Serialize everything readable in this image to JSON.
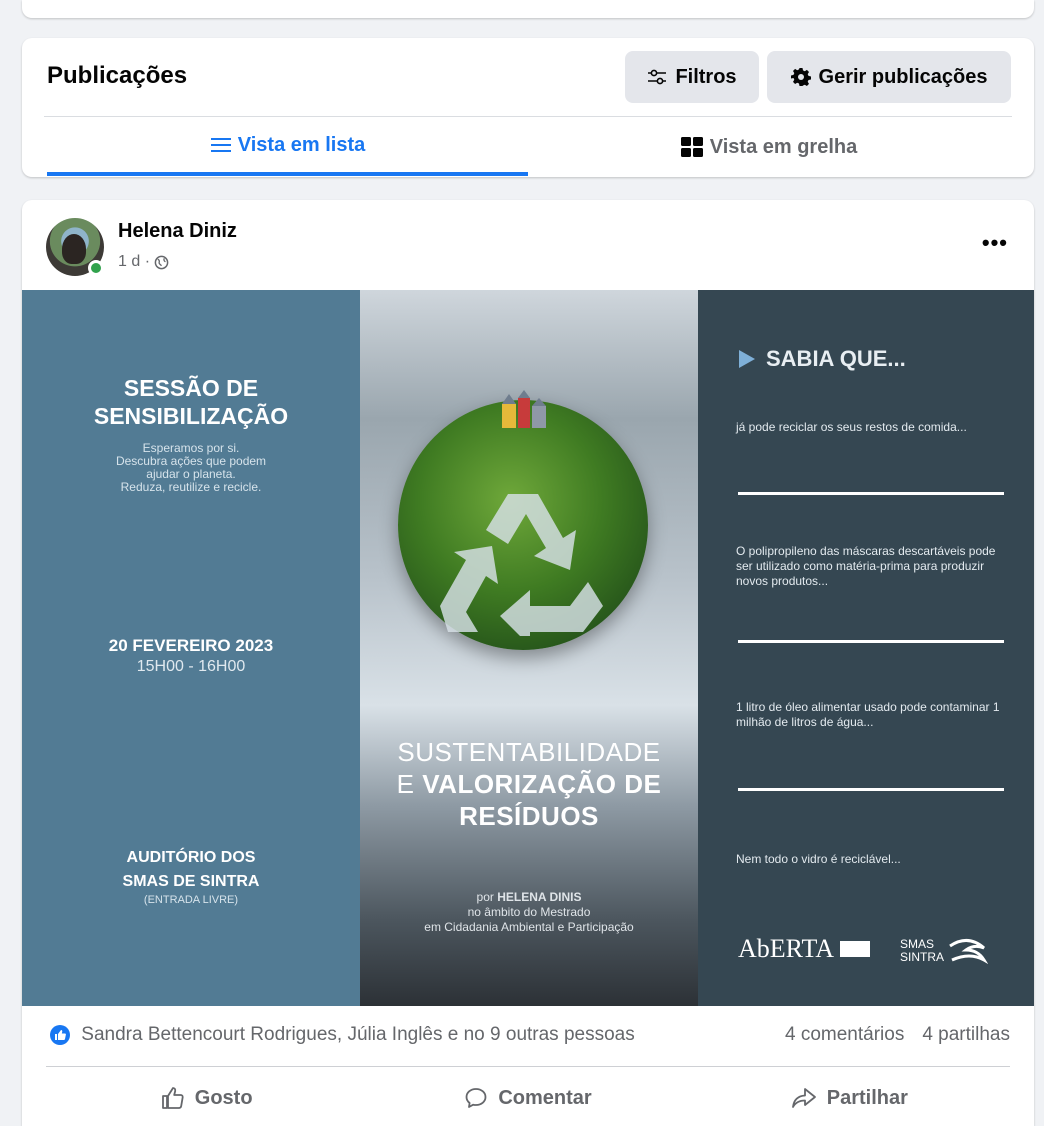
{
  "posts_header": {
    "title": "Publicações",
    "filters_label": "Filtros",
    "manage_label": "Gerir publicações",
    "tabs": [
      {
        "label": "Vista em lista",
        "active": true
      },
      {
        "label": "Vista em grelha",
        "active": false
      }
    ]
  },
  "post": {
    "author": "Helena Diniz",
    "time": "1 d ·",
    "poster": {
      "left": {
        "title_line1": "SESSÃO DE",
        "title_line2": "SENSIBILIZAÇÃO",
        "body_lines": [
          "Esperamos por si.",
          "Descubra ações que podem",
          "ajudar o planeta.",
          "Reduza, reutilize e recicle."
        ],
        "date": "20 FEVEREIRO 2023",
        "time": "15H00 - 16H00",
        "venue_line1": "AUDITÓRIO DOS",
        "venue_line2": "SMAS DE SINTRA",
        "venue_sub": "(ENTRADA LIVRE)"
      },
      "middle": {
        "title_line1": "SUSTENTABILIDADE",
        "title_line2_prefix": "E",
        "title_line2_bold": "VALORIZAÇÃO DE",
        "title_line3": "RESÍDUOS",
        "by_prefix": "por",
        "by_name": "HELENA DINIS",
        "by_line2": "no âmbito do Mestrado",
        "by_line3": "em Cidadania Ambiental e Participação"
      },
      "right": {
        "heading": "SABIA QUE...",
        "facts": [
          "já pode reciclar os seus restos de comida...",
          "O polipropileno das máscaras descartáveis pode ser utilizado como matéria-prima para produzir novos produtos...",
          "1 litro de óleo alimentar usado pode contaminar 1 milhão de litros de água...",
          "Nem todo o vidro é reciclável..."
        ],
        "logo_aberta": "AbERTA",
        "logo_smas_line1": "SMAS",
        "logo_smas_line2": "SINTRA"
      }
    },
    "reactions_text": "Sandra Bettencourt Rodrigues, Júlia Inglês e no 9 outras pessoas",
    "comments": "4 comentários",
    "shares": "4 partilhas",
    "actions": {
      "like": "Gosto",
      "comment": "Comentar",
      "share": "Partilhar"
    }
  },
  "colors": {
    "accent": "#1877f2",
    "poster_left": "#527b94",
    "poster_right": "#354752"
  }
}
